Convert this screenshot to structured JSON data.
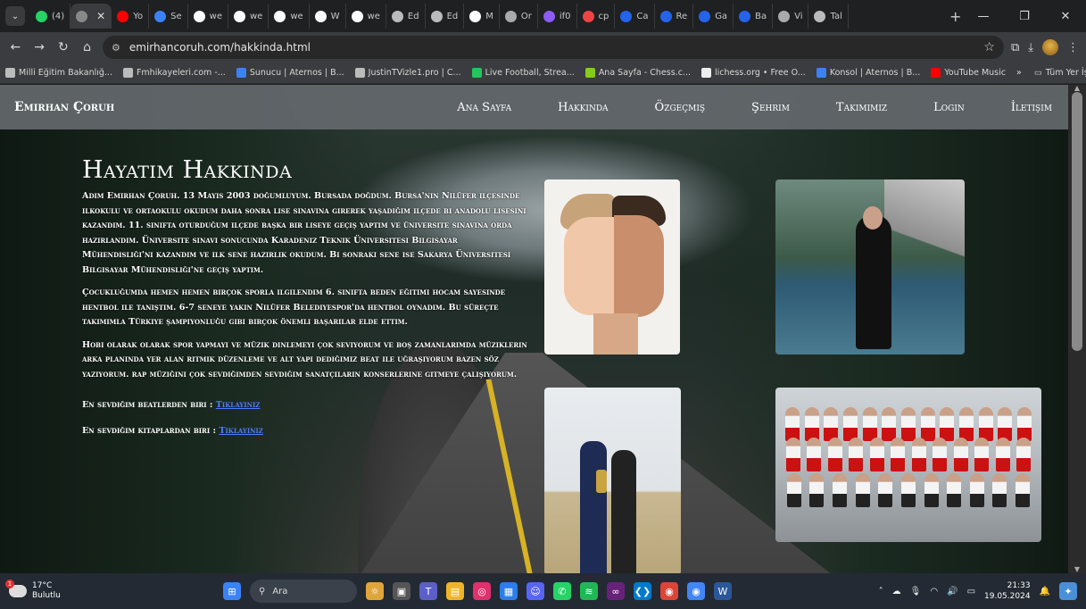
{
  "browser": {
    "tabs": [
      {
        "label": "(4)",
        "color": "#25d366"
      },
      {
        "label": "",
        "color": "#888",
        "active": true
      },
      {
        "label": "Yo",
        "color": "#ff0000"
      },
      {
        "label": "Se",
        "color": "#3b82f6"
      },
      {
        "label": "we",
        "color": "#ffffff"
      },
      {
        "label": "we",
        "color": "#ffffff"
      },
      {
        "label": "we",
        "color": "#ffffff"
      },
      {
        "label": "W",
        "color": "#ffffff"
      },
      {
        "label": "we",
        "color": "#ffffff"
      },
      {
        "label": "Ed",
        "color": "#bbbbbb"
      },
      {
        "label": "Ed",
        "color": "#bbbbbb"
      },
      {
        "label": "M",
        "color": "#ffffff"
      },
      {
        "label": "Or",
        "color": "#aaaaaa"
      },
      {
        "label": "if0",
        "color": "#8b5cf6"
      },
      {
        "label": "cp",
        "color": "#ef4444"
      },
      {
        "label": "Ca",
        "color": "#2563eb"
      },
      {
        "label": "Re",
        "color": "#2563eb"
      },
      {
        "label": "Ga",
        "color": "#2563eb"
      },
      {
        "label": "Ba",
        "color": "#2563eb"
      },
      {
        "label": "Vi",
        "color": "#aaaaaa"
      },
      {
        "label": "Tal",
        "color": "#bbbbbb"
      }
    ],
    "url": "emirhancoruh.com/hakkinda.html",
    "bookmarks": [
      {
        "label": "Milli Eğitim Bakanlığ...",
        "color": "#bbbbbb"
      },
      {
        "label": "Fmhikayeleri.com -...",
        "color": "#bbbbbb"
      },
      {
        "label": "Sunucu | Aternos | B...",
        "color": "#3b82f6"
      },
      {
        "label": "JustinTVizle1.pro | C...",
        "color": "#bbbbbb"
      },
      {
        "label": "Live Football, Strea...",
        "color": "#22c55e"
      },
      {
        "label": "Ana Sayfa - Chess.c...",
        "color": "#84cc16"
      },
      {
        "label": "lichess.org • Free O...",
        "color": "#eeeeee"
      },
      {
        "label": "Konsol | Aternos | B...",
        "color": "#3b82f6"
      },
      {
        "label": "YouTube Music",
        "color": "#ff0000"
      }
    ],
    "bookmarks_more": "»",
    "all_bookmarks": "Tüm Yer İşaretleri"
  },
  "site": {
    "brand": "Emirhan Çoruh",
    "menu": [
      "Ana Sayfa",
      "Hakkında",
      "Özgeçmiş",
      "Şehrim",
      "Takımımız",
      "Login",
      "İletişim"
    ],
    "heading": "Hayatım Hakkında",
    "paragraphs": [
      "Adım Emirhan Çoruh. 13 Mayıs 2003 doğumluyum. Bursada doğdum. Bursa'nın Nilüfer ilçesinde ilkokulu ve ortaokulu okudum daha sonra lise sınavına girerek yaşadığım ilçede bi anadolu lisesini kazandım. 11. sınıfta oturduğum ilçede başka bir liseye geçiş yaptım ve üniversite sınavına orda hazırlandım. Üniversite sınavı sonucunda Karadeniz Teknik Üniversitesi Bilgisayar Mühendisliği'ni kazandım ve ilk sene hazırlık okudum. Bi sonraki sene ise Sakarya Üniversitesi Bilgisayar Mühendisliği'ne geçiş yaptım.",
      "Çocukluğumda hemen hemen birçok sporla ilgilendim 6. sınıfta beden eğitimi hocam sayesinde hentbol ile tanıştım. 6-7 seneye yakın Nilüfer Belediyespor'da hentbol oynadım. Bu süreçte takımımla Türkiye şampiyonluğu gibi birçok önemli başarılar elde ettim.",
      "Hobi olarak olarak spor yapmayı ve müzik dinlemeyi çok seviyorum ve boş zamanlarımda müziklerin arka planında yer alan ritmik düzenleme ve alt yapı dediğimiz beat ile uğraşıyorum bazen söz yazıyorum. rap müziğini çok sevdiğimden sevdiğim sanatçıların konserlerine gitmeye çalışıyorum."
    ],
    "favorite_beat_label": "En sevdiğim beatlerden biri :",
    "favorite_beat_link": "Tıklayınız",
    "favorite_book_label": "En sevdiğim kitaplardan biri :",
    "favorite_book_link": "Tıklayınız"
  },
  "taskbar": {
    "weather_temp": "17°C",
    "weather_desc": "Bulutlu",
    "weather_badge": "1",
    "search_placeholder": "Ara",
    "time": "21:33",
    "date": "19.05.2024"
  }
}
